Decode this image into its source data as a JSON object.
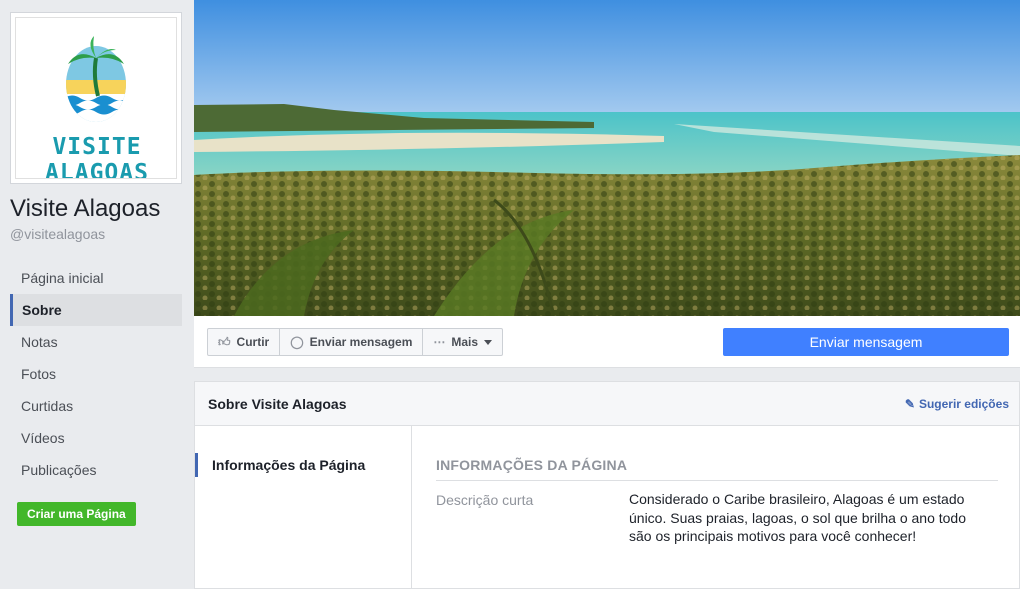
{
  "sidebar": {
    "logo_text": "VISITE ALAGOAS",
    "page_name": "Visite Alagoas",
    "handle": "@visitealagoas",
    "nav": [
      {
        "label": "Página inicial"
      },
      {
        "label": "Sobre"
      },
      {
        "label": "Notas"
      },
      {
        "label": "Fotos"
      },
      {
        "label": "Curtidas"
      },
      {
        "label": "Vídeos"
      },
      {
        "label": "Publicações"
      }
    ],
    "active_nav": "Sobre",
    "create_page_label": "Criar uma Página"
  },
  "actions": {
    "like_label": "Curtir",
    "like_icon": "thumbs-up-icon",
    "message_label": "Enviar mensagem",
    "message_icon": "messenger-icon",
    "more_label": "Mais",
    "more_icon": "ellipsis-icon",
    "primary_label": "Enviar mensagem"
  },
  "about": {
    "title": "Sobre Visite Alagoas",
    "suggest_label": "Sugerir edições",
    "left_item": "Informações da Página",
    "section_heading": "INFORMAÇÕES DA PÁGINA",
    "short_description_label": "Descrição curta",
    "short_description_value": "Considerado o Caribe brasileiro, Alagoas é um estado único. Suas praias, lagoas, o sol que brilha o ano todo são os principais motivos para você conhecer!"
  },
  "colors": {
    "primary_blue": "#4080ff",
    "link_blue": "#4267b2",
    "create_green": "#42b72a",
    "logo_teal": "#1a9bae"
  }
}
